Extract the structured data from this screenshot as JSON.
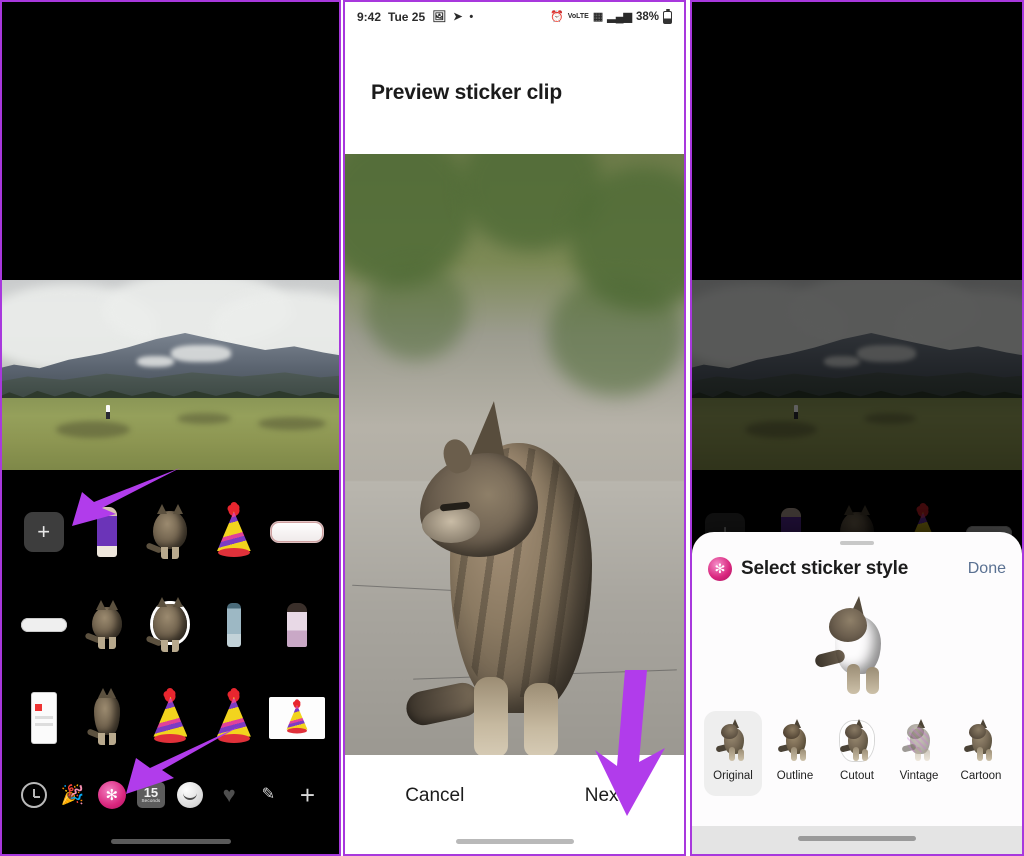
{
  "accent_color": "#a838dd",
  "panel1": {
    "name": "sticker-picker-screen",
    "add_button_label": "+",
    "stickers": [
      {
        "kind": "add",
        "label": "Add sticker"
      },
      {
        "kind": "person",
        "label": "Person in purple outfit sticker"
      },
      {
        "kind": "cat",
        "label": "Cat sticker"
      },
      {
        "kind": "hat",
        "label": "Party hat sticker"
      },
      {
        "kind": "note",
        "label": "Decorated note sticker"
      },
      {
        "kind": "note",
        "label": "Text pill sticker"
      },
      {
        "kind": "cat",
        "label": "Sitting cat sticker"
      },
      {
        "kind": "cat",
        "label": "Cat outline sticker"
      },
      {
        "kind": "bottle",
        "label": "Bottle sticker"
      },
      {
        "kind": "doll",
        "label": "Figurine sticker"
      },
      {
        "kind": "screenshot",
        "label": "Screenshot sticker"
      },
      {
        "kind": "cat",
        "label": "Standing cat sticker"
      },
      {
        "kind": "hat",
        "label": "Party hat sticker"
      },
      {
        "kind": "hat",
        "label": "Party hat sticker"
      },
      {
        "kind": "hatcard",
        "label": "Party hat on white card sticker"
      }
    ],
    "toolbar": [
      {
        "icon": "clock-icon",
        "label": "Recents"
      },
      {
        "icon": "party-popper-icon",
        "label": "Effects"
      },
      {
        "icon": "sticker-icon",
        "label": "Stickers",
        "selected": true
      },
      {
        "icon": "duration-badge",
        "number": "15",
        "unit": "Seconds",
        "label": "Clip duration"
      },
      {
        "icon": "smiley-icon",
        "label": "Emoji"
      },
      {
        "icon": "heart-icon",
        "label": "Favorites"
      },
      {
        "icon": "pen-icon",
        "label": "Draw"
      },
      {
        "icon": "plus-icon",
        "label": "Add"
      }
    ]
  },
  "panel2": {
    "name": "preview-sticker-clip-screen",
    "status_bar": {
      "time": "9:42",
      "date": "Tue 25",
      "left_icons": [
        "photo-icon",
        "telegram-icon",
        "dot-icon"
      ],
      "right_icons": [
        "alarm-icon",
        "volte-icon",
        "network-icon",
        "signal-icon"
      ],
      "battery_percent": "38%"
    },
    "title": "Preview sticker clip",
    "photo_caption": "Tabby cat sitting on concrete",
    "cancel_label": "Cancel",
    "next_label": "Next"
  },
  "panel3": {
    "name": "select-sticker-style-sheet",
    "sheet_icon": "sticker-icon",
    "sheet_title": "Select sticker style",
    "done_label": "Done",
    "preview_caption": "Cat sticker preview",
    "styles": [
      {
        "label": "Original",
        "selected": true
      },
      {
        "label": "Outline",
        "selected": false
      },
      {
        "label": "Cutout",
        "selected": false
      },
      {
        "label": "Vintage",
        "selected": false
      },
      {
        "label": "Cartoon",
        "selected": false
      }
    ]
  }
}
